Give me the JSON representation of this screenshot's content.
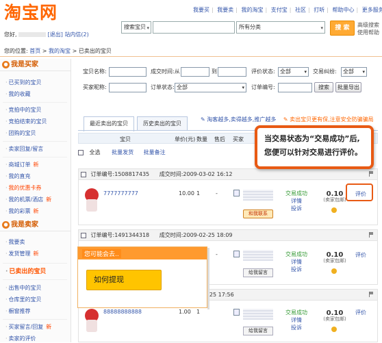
{
  "header": {
    "logo": "淘宝网",
    "top_links": [
      "我要买",
      "我要卖",
      "我的淘宝",
      "支付宝",
      "社区",
      "打听",
      "帮助中心",
      "更多服务"
    ],
    "greeting_prefix": "您好,",
    "logout": "[退出]",
    "inbox": "站内信(2)",
    "search": {
      "category": "搜索宝贝",
      "query": "",
      "scope": "所有分类",
      "button": "搜 索",
      "advanced": "高级搜索使用帮助"
    },
    "breadcrumb": {
      "prefix": "您的位置:",
      "home": "首页",
      "mytaobao": "我的淘宝",
      "current": "已卖出的宝贝"
    }
  },
  "sidebar": {
    "buyer_title": "我是买家",
    "buyer_items": [
      {
        "label": "已买到的宝贝",
        "new": ""
      },
      {
        "label": "我的收藏",
        "new": ""
      },
      {
        "label": "竞拍中的宝贝",
        "new": ""
      },
      {
        "label": "竞拍结束的宝贝",
        "new": ""
      },
      {
        "label": "团购的宝贝",
        "new": ""
      },
      {
        "label": "卖家回复/留言",
        "new": ""
      },
      {
        "label": "商城订单",
        "new": "新"
      },
      {
        "label": "我的直充",
        "new": ""
      },
      {
        "label": "我的优惠卡券",
        "new": ""
      },
      {
        "label": "我的机票/酒店",
        "new": "新"
      },
      {
        "label": "我的彩票",
        "new": "新"
      }
    ],
    "seller_title": "我是卖家",
    "seller_items": [
      {
        "label": "我要卖",
        "new": ""
      },
      {
        "label": "发货管理",
        "new": "新"
      }
    ],
    "active_item": "已卖出的宝贝",
    "seller_items2": [
      {
        "label": "出售中的宝贝",
        "new": ""
      },
      {
        "label": "仓库里的宝贝",
        "new": ""
      },
      {
        "label": "橱窗推荐",
        "new": ""
      },
      {
        "label": "买家留言/回复",
        "new": "新"
      },
      {
        "label": "卖家的评价",
        "new": ""
      }
    ]
  },
  "filters": {
    "item_name": "宝贝名称:",
    "deal_time": "成交时间:从",
    "to": "到",
    "rate_status": "评价状态:",
    "rate_status_value": "全部",
    "dispute": "交易纠纷:",
    "dispute_value": "全部",
    "buyer_nick": "买家昵称:",
    "order_status": "订单状态:",
    "order_status_value": "全部",
    "order_no": "订单编号:",
    "search_btn": "搜索",
    "export_btn": "批量导出"
  },
  "tabs": {
    "recent": "最近卖出的宝贝",
    "history": "历史卖出的宝贝",
    "note1": "淘客越多,卖得越多,推广越多",
    "note2": "卖出宝贝更有保,注意安全防骗骗局"
  },
  "columns": [
    "宝贝",
    "单价(元)",
    "数量",
    "售后",
    "买家",
    "交易状态",
    "实收款(元)",
    "评价"
  ],
  "bulk": {
    "select_all": "全选",
    "bulk_ship": "批量发货",
    "bulk_note": "批量备注"
  },
  "orders": [
    {
      "order_label": "订单编号:",
      "order_no": "1508817435",
      "time_label": "成交时间:",
      "time": "2009-03-02 16:12",
      "title": "7777777777",
      "price": "10.00",
      "qty": "1",
      "dash": "-",
      "chat": "和我联系",
      "status": "交易成功",
      "detail": "详情",
      "complain": "投诉",
      "amount": "0.10",
      "amount_note": "(卖家包邮)",
      "rate": "评价"
    },
    {
      "order_label": "订单编号:",
      "order_no": "1491344318",
      "time_label": "成交时间:",
      "time": "2009-02-25 18:09",
      "title": "",
      "price": "",
      "qty": "",
      "dash": "-",
      "chat": "给我留言",
      "status": "交易成功",
      "detail": "详情",
      "complain": "投诉",
      "amount": "0.10",
      "amount_note": "(卖家包邮)",
      "rate": "评价"
    },
    {
      "order_label": "",
      "order_no": "",
      "time_label": "",
      "time": "-25 17:56",
      "title": "88888888888",
      "price": "1.00",
      "qty": "1",
      "dash": "",
      "chat": "给我留言",
      "status": "交易成功",
      "detail": "详情",
      "complain": "投诉",
      "amount": "0.10",
      "amount_note": "(卖家包邮)",
      "rate": "评价"
    }
  ],
  "callout": "当交易状态为“交易成功”后,您便可以针对交易进行评价。",
  "popup": {
    "title": "您可能会去..",
    "button": "如何提现"
  },
  "colors": {
    "accent": "#e85a14",
    "link": "#3355aa",
    "logo": "#ff6600",
    "success": "#339933"
  }
}
